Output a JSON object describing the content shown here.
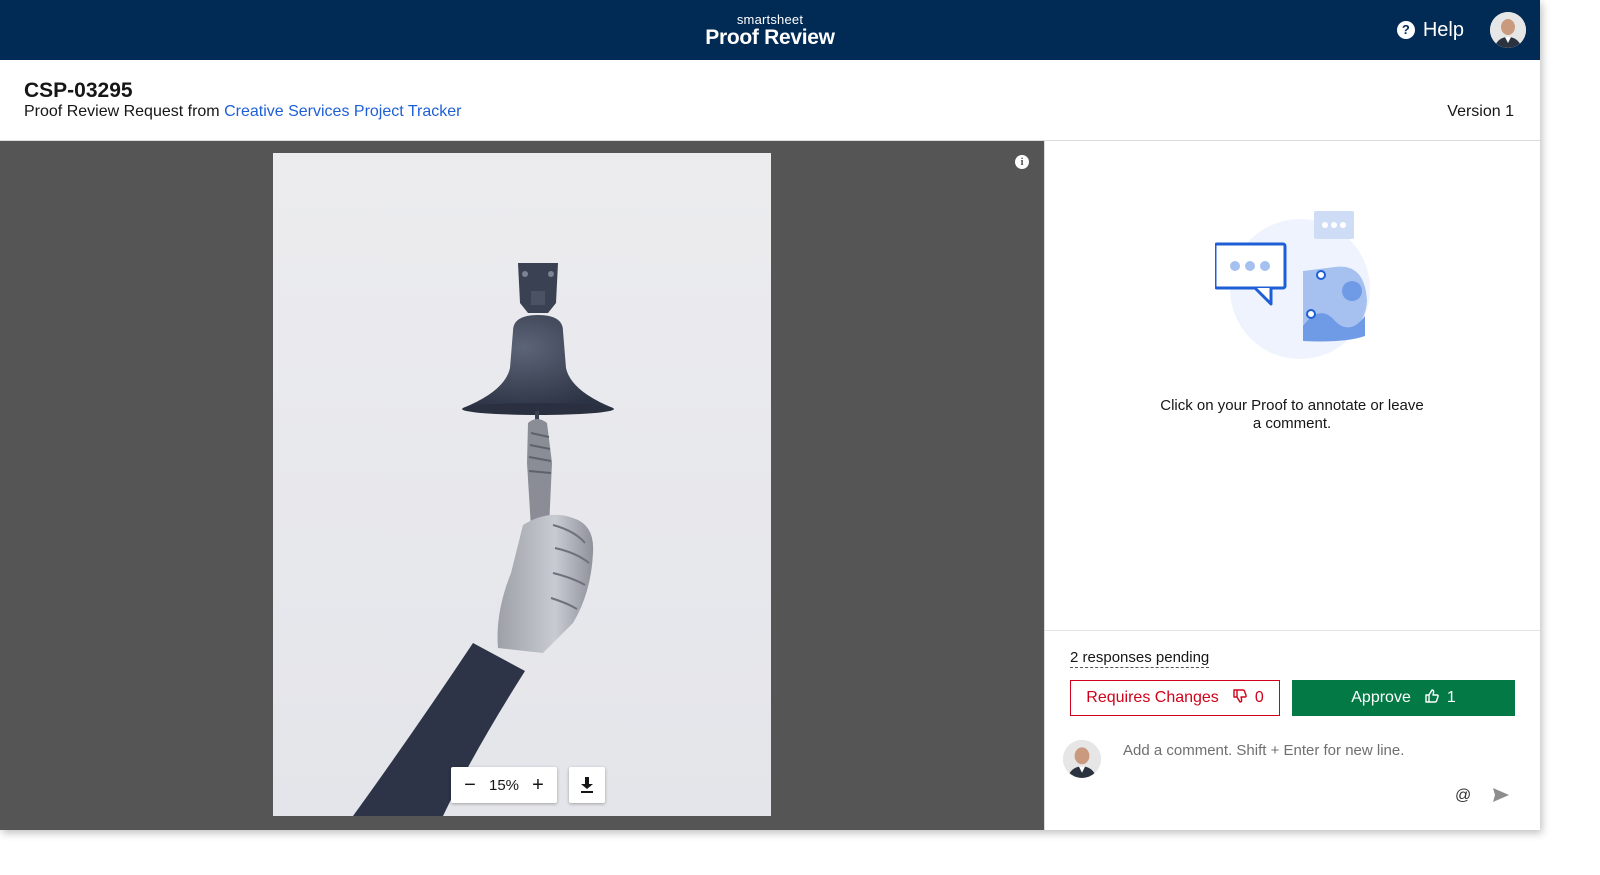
{
  "brand": {
    "company": "smartsheet",
    "product": "Proof Review"
  },
  "topbar": {
    "help_label": "Help"
  },
  "proof": {
    "id": "CSP-03295",
    "request_prefix": "Proof Review Request from ",
    "source_link": "Creative Services Project Tracker",
    "version": "Version 1"
  },
  "viewer": {
    "zoom_value": "15%",
    "zoom_out_label": "−",
    "zoom_in_label": "+",
    "info_label": "i"
  },
  "panel": {
    "empty_message": "Click on your Proof to annotate or leave a comment.",
    "responses_pending": "2 responses pending",
    "requires_changes_label": "Requires Changes",
    "requires_changes_count": "0",
    "approve_label": "Approve",
    "approve_count": "1",
    "comment_placeholder": "Add a comment. Shift + Enter for new line.",
    "mention_label": "@"
  },
  "colors": {
    "topbar": "#012a55",
    "link": "#1f5fd6",
    "approve": "#037a45",
    "requires_changes": "#d0021b",
    "viewer_bg": "#555555"
  },
  "icons": [
    "help-icon",
    "user-avatar",
    "info-icon",
    "download-icon",
    "thumbs-down-icon",
    "thumbs-up-icon",
    "at-mention-icon",
    "send-icon"
  ]
}
